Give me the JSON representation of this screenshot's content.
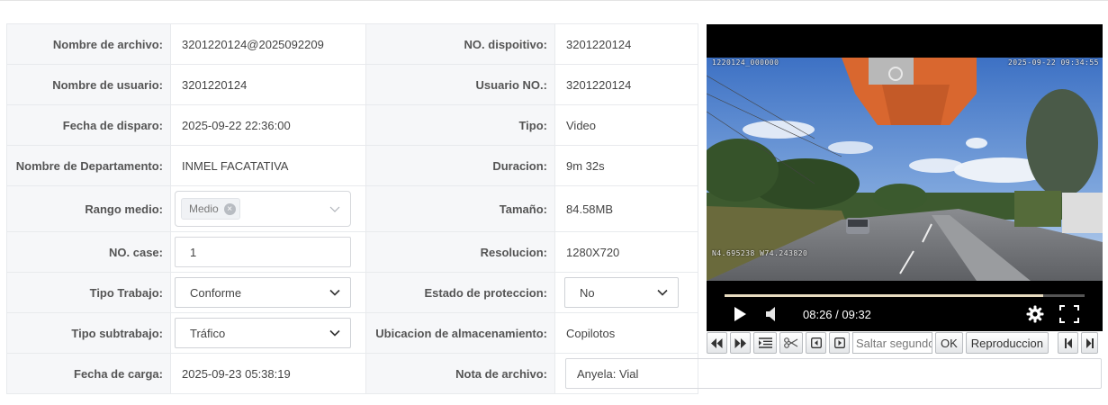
{
  "rows": {
    "nombre_archivo": {
      "label": "Nombre de archivo:",
      "value": "3201220124@2025092209"
    },
    "no_dispositivo": {
      "label": "NO. dispoitivo:",
      "value": "3201220124"
    },
    "nombre_usuario": {
      "label": "Nombre de usuario:",
      "value": "3201220124"
    },
    "usuario_no": {
      "label": "Usuario NO.:",
      "value": "3201220124"
    },
    "fecha_disparo": {
      "label": "Fecha de disparo:",
      "value": "2025-09-22 22:36:00"
    },
    "tipo": {
      "label": "Tipo:",
      "value": "Video"
    },
    "departamento": {
      "label": "Nombre de Departamento:",
      "value": "INMEL FACATATIVA"
    },
    "duracion": {
      "label": "Duracion:",
      "value": "9m 32s"
    },
    "rango_medio": {
      "label": "Rango medio:",
      "tag": "Medio"
    },
    "tamano": {
      "label": "Tamaño:",
      "value": "84.58MB"
    },
    "no_case": {
      "label": "NO. case:",
      "value": "1"
    },
    "resolucion": {
      "label": "Resolucion:",
      "value": "1280X720"
    },
    "tipo_trabajo": {
      "label": "Tipo Trabajo:",
      "value": "Conforme"
    },
    "estado_proteccion": {
      "label": "Estado de proteccion:",
      "value": "No"
    },
    "tipo_subtrabajo": {
      "label": "Tipo subtrabajo:",
      "value": "Tráfico"
    },
    "ubicacion": {
      "label": "Ubicacion de almacenamiento:",
      "value": "Copilotos"
    },
    "fecha_carga": {
      "label": "Fecha de carga:",
      "value": "2025-09-23 05:38:19"
    },
    "nota_archivo": {
      "label": "Nota de archivo:",
      "value": "Anyela: Vial"
    }
  },
  "video": {
    "osd_channel": "1220124_000000",
    "osd_datetime": "2025-09-22 09:34:55",
    "osd_gps": "N4.695238 W74.243820",
    "time_display": "08:26 / 09:32",
    "progress_fraction": 0.885,
    "icons": [
      "play-icon",
      "volume-icon",
      "gear-icon",
      "fullscreen-icon"
    ]
  },
  "toolbar": {
    "seek_placeholder": "Saltar segundos",
    "ok_label": "OK",
    "reproduccion_label": "Reproduccion",
    "icons": [
      "rewind-icon",
      "fast-forward-icon",
      "list-icon",
      "scissors-icon",
      "frame-back-icon",
      "frame-forward-icon",
      "skip-start-icon",
      "skip-end-icon"
    ]
  },
  "colors": {
    "label_bg": "#f6f7f9",
    "border": "#e8eaed",
    "video_bg": "#000000",
    "progress": "#e8dcc0"
  }
}
